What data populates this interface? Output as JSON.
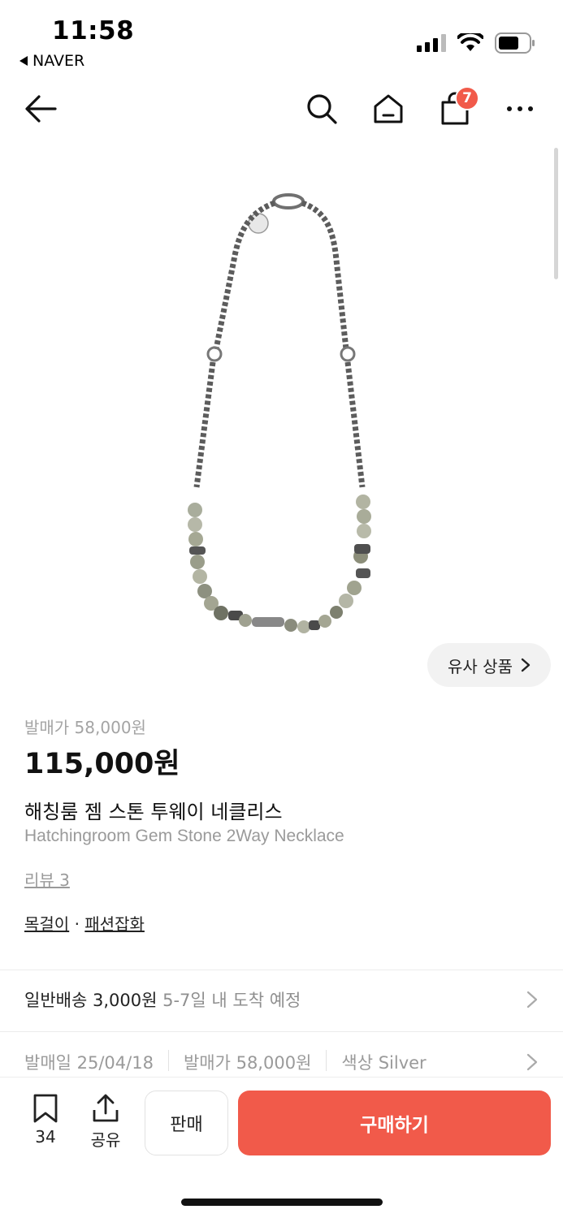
{
  "status_bar": {
    "time": "11:58",
    "back_app": "NAVER"
  },
  "nav": {
    "cart_count": "7"
  },
  "image": {
    "similar_button": "유사 상품"
  },
  "product": {
    "original_price": "발매가 58,000원",
    "price": "115,000원",
    "name_ko": "해칭룸 젬 스톤 투웨이 네클리스",
    "name_en": "Hatchingroom Gem Stone 2Way Necklace",
    "review": "리뷰 3",
    "category_1": "목걸이",
    "category_sep": "·",
    "category_2": "패션잡화"
  },
  "shipping": {
    "main": "일반배송 3,000원",
    "sub": "5-7일 내 도착 예정"
  },
  "info": {
    "release_date": "발매일 25/04/18",
    "release_price": "발매가 58,000원",
    "color": "색상 Silver"
  },
  "bottom": {
    "bookmark_count": "34",
    "share_label": "공유",
    "sell_label": "판매",
    "buy_label": "구매하기"
  },
  "colors": {
    "accent": "#f15a4a"
  }
}
